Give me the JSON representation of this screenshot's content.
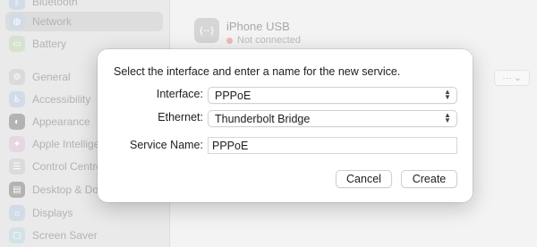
{
  "sidebar": {
    "items": [
      {
        "label": "Bluetooth",
        "icon": "bluetooth-icon",
        "color": "#c3cfe0"
      },
      {
        "label": "Network",
        "icon": "globe-icon",
        "color": "#c3cfe0",
        "selected": true
      },
      {
        "label": "Battery",
        "icon": "battery-icon",
        "color": "#c8d8c0"
      },
      {
        "label": "General",
        "icon": "gear-icon",
        "color": "#cfcfcf"
      },
      {
        "label": "Accessibility",
        "icon": "accessibility-icon",
        "color": "#c3cfe0"
      },
      {
        "label": "Appearance",
        "icon": "appearance-icon",
        "color": "#9a9a9a"
      },
      {
        "label": "Apple Intelligence",
        "icon": "apple-intelligence-icon",
        "color": "#e0c8d8"
      },
      {
        "label": "Control Centre",
        "icon": "control-centre-icon",
        "color": "#cfcfcf"
      },
      {
        "label": "Desktop & Dock",
        "icon": "dock-icon",
        "color": "#9a9a9a"
      },
      {
        "label": "Displays",
        "icon": "display-icon",
        "color": "#c3cfe0"
      },
      {
        "label": "Screen Saver",
        "icon": "screen-saver-icon",
        "color": "#c3d8e0"
      }
    ]
  },
  "service": {
    "name": "iPhone USB",
    "status": "Not connected",
    "icon": "usb-icon",
    "status_color": "#e8a3a0"
  },
  "more_button": {
    "label": "··· ⌄"
  },
  "dialog": {
    "title": "Select the interface and enter a name for the new service.",
    "interface_label": "Interface:",
    "interface_value": "PPPoE",
    "ethernet_label": "Ethernet:",
    "ethernet_value": "Thunderbolt Bridge",
    "service_name_label": "Service Name:",
    "service_name_value": "PPPoE",
    "cancel_label": "Cancel",
    "create_label": "Create"
  }
}
